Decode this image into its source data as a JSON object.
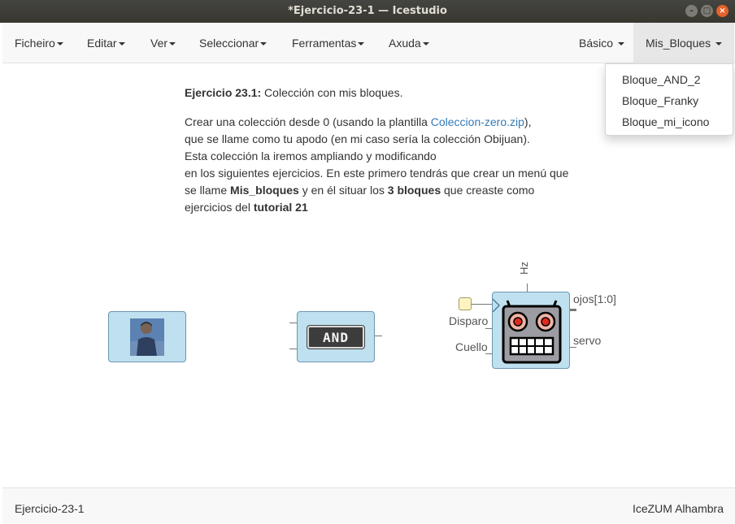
{
  "window": {
    "title": "*Ejercicio-23-1 — Icestudio"
  },
  "menubar": {
    "items": [
      {
        "label": "Ficheiro"
      },
      {
        "label": "Editar"
      },
      {
        "label": "Ver"
      },
      {
        "label": "Seleccionar"
      },
      {
        "label": "Ferramentas"
      },
      {
        "label": "Axuda"
      }
    ],
    "right_items": [
      {
        "label": "Básico"
      },
      {
        "label": "Mis_Bloques"
      }
    ]
  },
  "dropdown": {
    "items": [
      {
        "label": "Bloque_AND_2"
      },
      {
        "label": "Bloque_Franky"
      },
      {
        "label": "Bloque_mi_icono"
      }
    ]
  },
  "description": {
    "heading_bold": "Ejercicio 23.1:",
    "heading_rest": " Colección con mis bloques.",
    "p1_a": "Crear una colección desde 0 (usando la plantilla ",
    "p1_link": "Coleccion-zero.zip",
    "p1_b": "),",
    "p1_c": "que se llame como tu apodo (en mi caso sería la colección Obijuan).",
    "p1_d": "Esta colección la iremos ampliando y modificando",
    "p1_e": "en los siguientes ejercicios. En este primero tendrás que crear un menú que",
    "p1_f": "se llame ",
    "p1_g_bold": "Mis_bloques",
    "p1_h": " y en él situar los ",
    "p1_i_bold": "3 bloques",
    "p1_j": " que creaste como",
    "p1_k": "ejercicios del ",
    "p1_l_bold": "tutorial 21"
  },
  "blocks": {
    "and_label": "AND",
    "franky": {
      "in_top": "Hz",
      "in_disparo": "Disparo",
      "in_cuello": "Cuello",
      "out_ojos": "ojos[1:0]",
      "out_servo": "servo"
    }
  },
  "statusbar": {
    "left": "Ejercicio-23-1",
    "right": "IceZUM Alhambra"
  },
  "colors": {
    "block_fill": "#bfe0ef",
    "link": "#337ab7",
    "close_button": "#e4622c"
  }
}
